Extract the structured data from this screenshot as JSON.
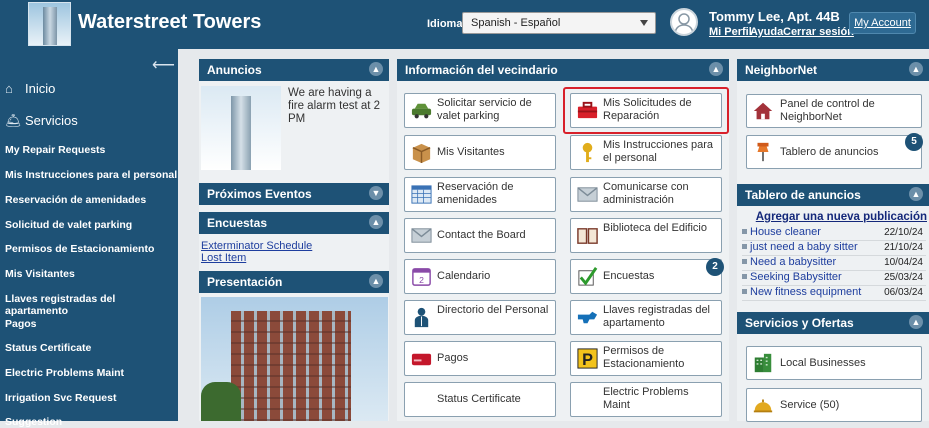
{
  "header": {
    "title": "Waterstreet Towers",
    "lang_label": "Idioma:",
    "lang_value": "Spanish - Español",
    "user": "Tommy Lee, Apt. 44B",
    "links": [
      "Mi Perfil",
      "Ayuda",
      "Cerrar sesión"
    ],
    "account": "My Account"
  },
  "sidebar": {
    "top": [
      "Inicio",
      "Servicios"
    ],
    "items": [
      "My Repair Requests",
      "Mis Instrucciones para el personal",
      "Reservación de amenidades",
      "Solicitud de valet parking",
      "Permisos de Estacionamiento",
      "Mis Visitantes",
      "Llaves registradas del apartamento",
      "Pagos",
      "Status Certificate",
      "Electric Problems Maint",
      "Irrigation Svc Request",
      "Suggestion"
    ]
  },
  "anuncios": {
    "title": "Anuncios",
    "text": "We are having a fire alarm test at 2 PM"
  },
  "eventos": {
    "title": "Próximos Eventos"
  },
  "encuestas": {
    "title": "Encuestas",
    "links": [
      "Exterminator Schedule",
      "Lost Item"
    ]
  },
  "presentacion": {
    "title": "Presentación"
  },
  "vecindario": {
    "title": "Información del vecindario",
    "tiles": [
      {
        "label": "Solicitar servicio de valet parking",
        "icon": "car-icon"
      },
      {
        "label": "Mis Solicitudes de Reparación",
        "icon": "toolbox-icon"
      },
      {
        "label": "Mis Visitantes",
        "icon": "visitors-box-icon"
      },
      {
        "label": "Mis Instrucciones para el personal",
        "icon": "key-icon"
      },
      {
        "label": "Reservación de amenidades",
        "icon": "calendar-grid-icon"
      },
      {
        "label": "Comunicarse con administración",
        "icon": "envelope-icon"
      },
      {
        "label": "Contact the Board",
        "icon": "envelope-icon"
      },
      {
        "label": "Biblioteca del Edificio",
        "icon": "book-icon"
      },
      {
        "label": "Calendario",
        "icon": "calendar-icon"
      },
      {
        "label": "Encuestas",
        "icon": "checkmark-icon",
        "badge": "2"
      },
      {
        "label": "Directorio del Personal",
        "icon": "person-icon"
      },
      {
        "label": "Llaves registradas del apartamento",
        "icon": "key-ring-icon"
      },
      {
        "label": "Pagos",
        "icon": "credit-card-icon"
      },
      {
        "label": "Permisos de Estacionamiento",
        "icon": "parking-icon"
      },
      {
        "label": "Status Certificate",
        "icon": ""
      },
      {
        "label": "Electric Problems Maint",
        "icon": ""
      }
    ]
  },
  "neighbornet": {
    "title": "NeighborNet",
    "tiles": [
      {
        "label": "Panel de control de NeighborNet",
        "icon": "house-icon"
      },
      {
        "label": "Tablero de anuncios",
        "icon": "pushpin-icon",
        "badge": "5"
      }
    ]
  },
  "tablero": {
    "title": "Tablero de anuncios",
    "add": "Agregar una nueva publicación",
    "rows": [
      {
        "text": "House cleaner",
        "date": "22/10/24"
      },
      {
        "text": "just need a baby sitter",
        "date": "21/10/24"
      },
      {
        "text": "Need a babysitter",
        "date": "10/04/24"
      },
      {
        "text": "Seeking Babysitter",
        "date": "25/03/24"
      },
      {
        "text": "New fitness equipment",
        "date": "06/03/24"
      }
    ]
  },
  "servicios": {
    "title": "Servicios y Ofertas",
    "tiles": [
      {
        "label": "Local Businesses",
        "icon": "building-icon"
      },
      {
        "label": "Service (50)",
        "icon": "service-bell-icon"
      }
    ]
  },
  "colors": {
    "navy": "#1e5276",
    "highlight": "#d8202a"
  }
}
